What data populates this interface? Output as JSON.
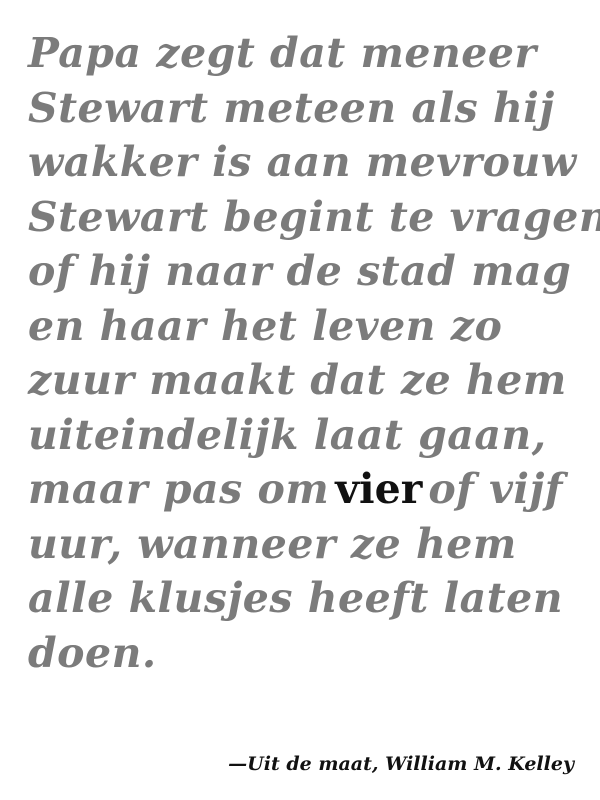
{
  "quote": {
    "lines": [
      "Papa zegt dat meneer",
      "Stewart meteen als hij",
      "wakker is aan mevrouw",
      "Stewart begint te vragen",
      "of hij naar de stad mag",
      "en haar het leven zo",
      "zuur maakt dat ze hem",
      "uiteindelijk laat gaan,",
      "maar pas om",
      "uur, wanneer ze hem",
      "alle klusjes heeft laten",
      "doen."
    ],
    "highlighted_word": "vier",
    "line9_tail": "of vijf"
  },
  "attribution": "—Uit de maat, William M. Kelley",
  "colors": {
    "quote_text": "#7b7b7b",
    "highlight": "#111111",
    "attribution": "#111111",
    "background": "#ffffff"
  }
}
